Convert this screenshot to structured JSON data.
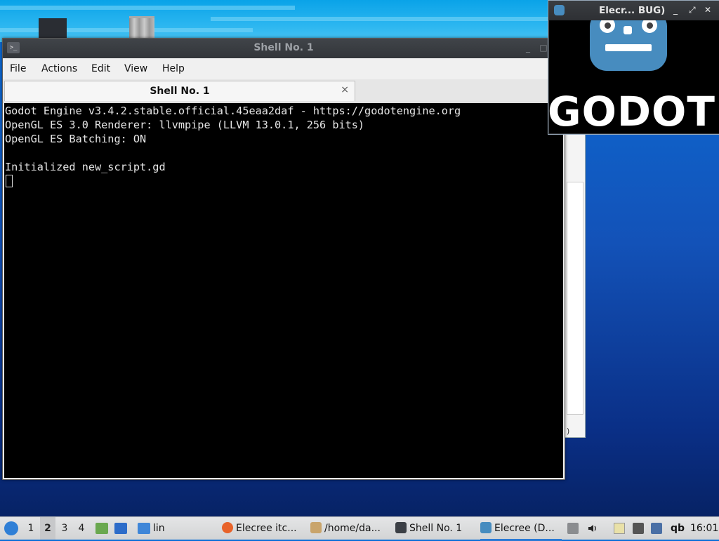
{
  "terminal": {
    "window_title": "Shell No. 1",
    "menu": [
      "File",
      "Actions",
      "Edit",
      "View",
      "Help"
    ],
    "tab_label": "Shell No. 1",
    "tab_close": "×",
    "lines": [
      "Godot Engine v3.4.2.stable.official.45eaa2daf - https://godotengine.org",
      "OpenGL ES 3.0 Renderer: llvmpipe (LLVM 13.0.1, 256 bits)",
      "OpenGL ES Batching: ON",
      "",
      "Initialized new_script.gd"
    ]
  },
  "godot_window": {
    "title": "Elecr... BUG)",
    "logo_text": "GODOT",
    "buttons": [
      "_",
      "⤢",
      "✕"
    ]
  },
  "back_window": {
    "glyph": ")"
  },
  "taskbar": {
    "workspaces": [
      "1",
      "2",
      "3",
      "4"
    ],
    "active_workspace": "2",
    "quicklaunch_label": "lin",
    "tasks": [
      {
        "label": "Elecree itc...",
        "icon": "firefox-icon",
        "color": "#e8632a"
      },
      {
        "label": "/home/da...",
        "icon": "file-manager-icon",
        "color": "#c9a46b"
      },
      {
        "label": "Shell No. 1",
        "icon": "terminal-icon",
        "color": "#3b3f45"
      },
      {
        "label": "Elecree (D...",
        "icon": "godot-icon",
        "color": "#478cbf"
      }
    ],
    "tray_text": "qb",
    "clock": "16:01"
  }
}
